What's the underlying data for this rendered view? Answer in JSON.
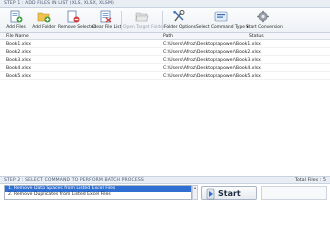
{
  "step1": {
    "title": "STEP 1 : ADD FILES IN LIST (XLS, XLSX, XLSM)"
  },
  "toolbar": {
    "add_files": "Add Files",
    "add_folder": "Add Folder",
    "remove_selected": "Remove Selected",
    "clear_file_list": "Clear File List",
    "open_target_folder": "Open Target Folder",
    "folder_options": "Folder Options",
    "select_command_type": "Select Command Type",
    "start_conversion": "Start Conversion"
  },
  "grid": {
    "headers": {
      "file_name": "File Name",
      "path": "Path",
      "status": "Status"
    },
    "rows": [
      {
        "name": "Book1.xlsx",
        "path": "C:\\Users\\Afroz\\Desktop\\apower\\Book1.xlsx",
        "status": ""
      },
      {
        "name": "Book2.xlsx",
        "path": "C:\\Users\\Afroz\\Desktop\\apower\\Book2.xlsx",
        "status": ""
      },
      {
        "name": "Book3.xlsx",
        "path": "C:\\Users\\Afroz\\Desktop\\apower\\Book3.xlsx",
        "status": ""
      },
      {
        "name": "Book4.xlsx",
        "path": "C:\\Users\\Afroz\\Desktop\\apower\\Book4.xlsx",
        "status": ""
      },
      {
        "name": "Book5.xlsx",
        "path": "C:\\Users\\Afroz\\Desktop\\apower\\Book5.xlsx",
        "status": ""
      }
    ]
  },
  "step2": {
    "title": "STEP 2 : SELECT COMMAND TO PERFORM BATCH PROCESS",
    "total_files": "Total Files : 5"
  },
  "commands": [
    "1. Remove Data Spaces from Listed Excel Files",
    "2. Remove Duplicates from Listed Excel Files"
  ],
  "start": {
    "label": "Start"
  },
  "colors": {
    "selection": "#2f6fd1",
    "header_bg": "#e9eef5",
    "header_text": "#4a5a70"
  },
  "icons": [
    "add-files-icon",
    "add-folder-icon",
    "remove-selected-icon",
    "clear-list-icon",
    "open-folder-icon",
    "folder-options-icon",
    "command-type-icon",
    "start-conversion-icon",
    "start-icon"
  ]
}
